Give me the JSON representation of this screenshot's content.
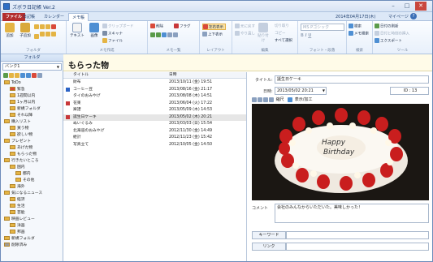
{
  "window": {
    "title": "ズボラ日記帳 Ver.2",
    "controls": [
      "–",
      "□",
      "✕"
    ]
  },
  "menubar": {
    "tabs": [
      "ファイル",
      "日記帳",
      "カレンダー",
      "メモ帳"
    ],
    "date": "2014年04月17日(木)",
    "mypage": "マイページ"
  },
  "ribbon": {
    "groups": [
      {
        "label": "フォルダ"
      },
      {
        "label": "メモ作成"
      },
      {
        "label": "メモ一覧"
      },
      {
        "label": "レイアウト"
      },
      {
        "label": "編集"
      },
      {
        "label": "フォント・段落"
      },
      {
        "label": "検索"
      },
      {
        "label": "ツール"
      }
    ],
    "folder_buttons": [
      "追加",
      "子追加"
    ],
    "memo_create": {
      "text": "テキスト",
      "image": "画像",
      "clipboard": "クリップボード",
      "scanner": "スキャナ",
      "file": "ファイル"
    },
    "memo_list": {
      "delete": "削除",
      "flag": "フラグ"
    },
    "layout": {
      "lr": "左右表示",
      "ud": "上下表示"
    },
    "edit": {
      "undo": "元に戻す",
      "redo": "やり直し",
      "paste": "貼り付け",
      "cut": "切り取り",
      "copy": "コピー",
      "selectall": "すべて選択"
    },
    "font": {
      "family": "MS Pゴシック",
      "bold": "B",
      "italic": "I",
      "underline": "U"
    },
    "search": {
      "find": "検索",
      "memo_search": "メモ検索"
    },
    "tools": {
      "diary": "日付の刷新",
      "insert": "日付と時刻の挿入",
      "export": "エクスポート"
    }
  },
  "sidebar": {
    "header": "フォルダ",
    "combo": "バンク1",
    "tree": [
      {
        "label": "ToDo",
        "level": 0,
        "color": "#e4b444"
      },
      {
        "label": "緊急",
        "level": 1,
        "color": "#d94a3a"
      },
      {
        "label": "1週間以内",
        "level": 1,
        "color": "#e4b444"
      },
      {
        "label": "1ヶ月以内",
        "level": 1,
        "color": "#e4b444"
      },
      {
        "label": "新規フォルダ",
        "level": 1,
        "color": "#e4b444"
      },
      {
        "label": "それ以降",
        "level": 1,
        "color": "#e4b444"
      },
      {
        "label": "購入リスト",
        "level": 0,
        "color": "#e4b444"
      },
      {
        "label": "買う物",
        "level": 1,
        "color": "#e4b444"
      },
      {
        "label": "欲しい物",
        "level": 1,
        "color": "#e4b444"
      },
      {
        "label": "プレゼント",
        "level": 0,
        "color": "#e4b444"
      },
      {
        "label": "あげた物",
        "level": 1,
        "color": "#e4b444"
      },
      {
        "label": "もらった物",
        "level": 1,
        "color": "#e4b444"
      },
      {
        "label": "行きたいところ",
        "level": 0,
        "color": "#e4b444"
      },
      {
        "label": "国内",
        "level": 1,
        "color": "#e4b444"
      },
      {
        "label": "都内",
        "level": 2,
        "color": "#e4b444"
      },
      {
        "label": "その他",
        "level": 2,
        "color": "#e4b444"
      },
      {
        "label": "海外",
        "level": 1,
        "color": "#e4b444"
      },
      {
        "label": "気になるニュース",
        "level": 0,
        "color": "#e4b444"
      },
      {
        "label": "経済",
        "level": 1,
        "color": "#e4b444"
      },
      {
        "label": "生活",
        "level": 1,
        "color": "#e4b444"
      },
      {
        "label": "芸能",
        "level": 1,
        "color": "#e4b444"
      },
      {
        "label": "映画レビュー",
        "level": 0,
        "color": "#e4b444"
      },
      {
        "label": "洋画",
        "level": 1,
        "color": "#e4b444"
      },
      {
        "label": "邦画",
        "level": 1,
        "color": "#e4b444"
      },
      {
        "label": "新規フォルダ",
        "level": 0,
        "color": "#e4b444"
      },
      {
        "label": "削除済み",
        "level": 0,
        "color": "#9c9c9c"
      }
    ]
  },
  "main": {
    "title": "もらった物",
    "list": {
      "headers": [
        "タイトル",
        "日時"
      ],
      "rows": [
        {
          "title": "財布",
          "date": "2013/10/11 (金) 19:51",
          "flag": ""
        },
        {
          "title": "コーヒー豆",
          "date": "2013/08/16 (金) 21:17",
          "flag": "#2b63c6"
        },
        {
          "title": "タイのおみやげ",
          "date": "2013/08/08 (木) 14:51",
          "flag": ""
        },
        {
          "title": "花束",
          "date": "2013/06/04 (火) 17:22",
          "flag": "#c8373a"
        },
        {
          "title": "楽譜",
          "date": "2013/05/09 (木) 14:53",
          "flag": ""
        },
        {
          "title": "誕生日ケーキ",
          "date": "2013/05/02 (木) 20:21",
          "flag": "#c8373a"
        },
        {
          "title": "ぬいぐるみ",
          "date": "2013/03/03 (日) 15:54",
          "flag": ""
        },
        {
          "title": "北海道のおみやげ",
          "date": "2012/11/30 (金) 14:49",
          "flag": ""
        },
        {
          "title": "絵計",
          "date": "2012/11/23 (金) 15:42",
          "flag": ""
        },
        {
          "title": "写真立て",
          "date": "2012/10/05 (金) 14:50",
          "flag": ""
        }
      ]
    },
    "detail": {
      "title_label": "タイトル:",
      "title_value": "誕生日ケーキ",
      "date_label": "日時:",
      "date_value": "2013/05/02 20:21",
      "id_label": "ID : 13",
      "image_toolbar": {
        "fit": "縮尺",
        "display": "表示/加工"
      },
      "comment_label": "コメント",
      "comment_value": "会社のみんなからいただいた。美味しかった！",
      "keyword_label": "キーワード",
      "link_label": "リンク"
    }
  }
}
